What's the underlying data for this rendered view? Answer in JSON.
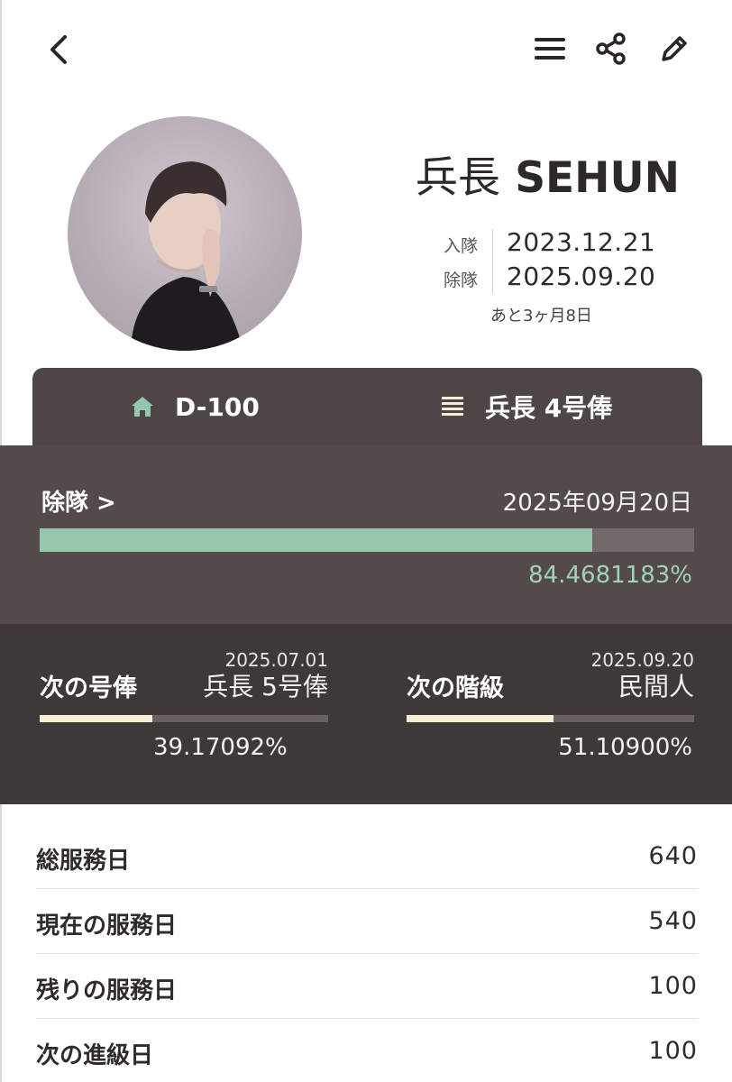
{
  "header": {
    "back_icon": "chevron-left-icon",
    "menu_icon": "list-icon",
    "share_icon": "share-icon",
    "edit_icon": "pencil-icon"
  },
  "profile": {
    "rank": "兵長",
    "name": "SEHUN",
    "enlist_label": "入隊",
    "enlist_date": "2023.12.21",
    "discharge_label": "除隊",
    "discharge_date": "2025.09.20",
    "remaining": "あと3ヶ月8日"
  },
  "tabs": [
    {
      "label": "D-100",
      "icon": "home-icon"
    },
    {
      "label": "兵長 4号俸",
      "icon": "stripes-icon"
    }
  ],
  "discharge": {
    "title": "除隊 >",
    "date": "2025年09月20日",
    "percent_text": "84.4681183%",
    "progress": 0.844681183
  },
  "next_pay": {
    "date": "2025.07.01",
    "title": "次の号俸",
    "value": "兵長 5号俸",
    "percent_text": "39.17092%",
    "progress": 0.3917092
  },
  "next_rank": {
    "date": "2025.09.20",
    "title": "次の階級",
    "value": "民間人",
    "percent_text": "51.10900%",
    "progress": 0.51109
  },
  "stats": [
    {
      "label": "総服務日",
      "value": "640"
    },
    {
      "label": "現在の服務日",
      "value": "540"
    },
    {
      "label": "残りの服務日",
      "value": "100"
    },
    {
      "label": "次の進級日",
      "value": "100"
    }
  ],
  "colors": {
    "accent_green": "#96c7ae",
    "accent_cream": "#f6efd6",
    "panel_dark": "#3f3838",
    "panel_mid": "#544a4a",
    "tab_bg": "#4e4646"
  }
}
